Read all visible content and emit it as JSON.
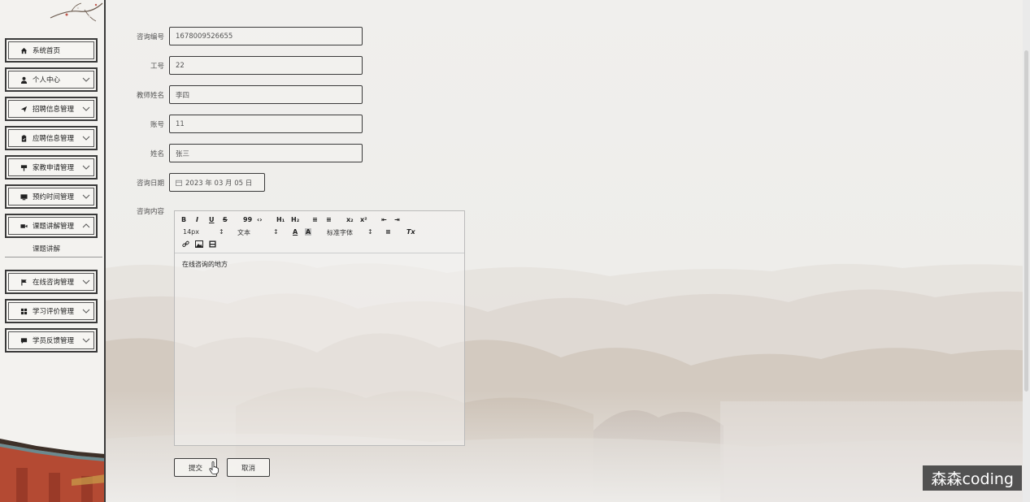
{
  "sidebar": {
    "items": [
      {
        "label": "系统首页",
        "icon": "home-icon"
      },
      {
        "label": "个人中心",
        "icon": "user-icon"
      },
      {
        "label": "招聘信息管理",
        "icon": "send-icon"
      },
      {
        "label": "应聘信息管理",
        "icon": "clipboard-icon"
      },
      {
        "label": "家教申请管理",
        "icon": "signpost-icon"
      },
      {
        "label": "预约时间管理",
        "icon": "monitor-icon"
      },
      {
        "label": "课题讲解管理",
        "icon": "video-icon"
      },
      {
        "label": "在线咨询管理",
        "icon": "flag-icon"
      },
      {
        "label": "学习评价管理",
        "icon": "grid-icon"
      },
      {
        "label": "学员反馈管理",
        "icon": "comment-icon"
      }
    ],
    "submenu": {
      "label": "课题讲解"
    }
  },
  "form": {
    "fields": [
      {
        "label": "咨询编号",
        "value": "1678009526655"
      },
      {
        "label": "工号",
        "value": "22"
      },
      {
        "label": "教师姓名",
        "value": "李四"
      },
      {
        "label": "账号",
        "value": "11"
      },
      {
        "label": "姓名",
        "value": "张三"
      }
    ],
    "date": {
      "label": "咨询日期",
      "value": "2023 年 03 月 05 日"
    },
    "content": {
      "label": "咨询内容",
      "value": "在线咨询的地方"
    },
    "toolbar": {
      "bold": "B",
      "italic": "I",
      "underline": "U",
      "strike": "S",
      "quote": "99",
      "code": "‹›",
      "h1": "H₁",
      "h2": "H₂",
      "ol": "≡",
      "ul": "≡",
      "sub": "x₂",
      "sup": "x²",
      "indent_dec": "⇤",
      "indent_inc": "⇥",
      "size": "14px",
      "type": "文本",
      "font": "标准字体",
      "color": "A",
      "bg": "A",
      "align": "≡",
      "clear": "Tx"
    },
    "submit_label": "提交",
    "cancel_label": "取消"
  },
  "watermark": "森森coding"
}
